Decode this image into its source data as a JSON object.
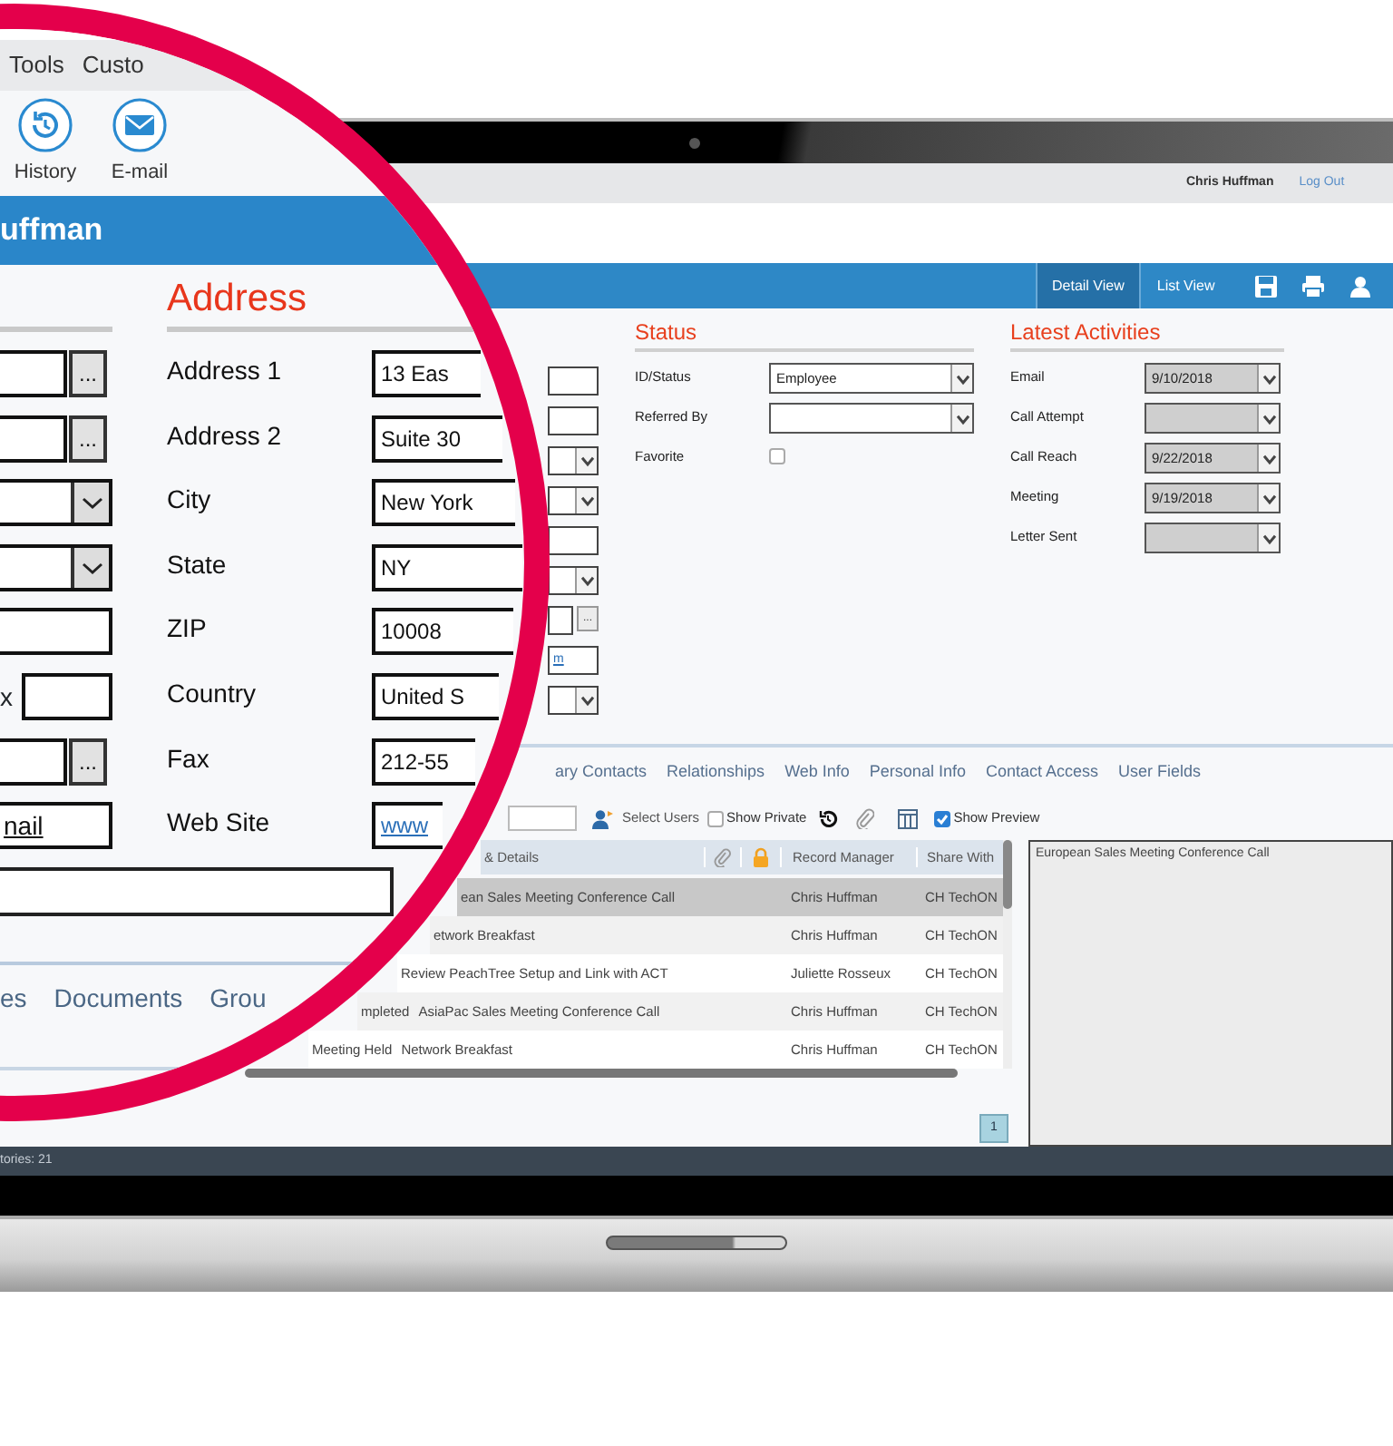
{
  "magnifier": {
    "menu": [
      {
        "label": "Tools"
      },
      {
        "label": "Custo"
      }
    ],
    "toolbar": [
      {
        "kind": "history",
        "label": "History"
      },
      {
        "kind": "email",
        "label": "E-mail"
      }
    ],
    "record_title": "uffman",
    "left_fields": [
      {
        "kind": "lookup",
        "button": "..."
      },
      {
        "kind": "lookup",
        "button": "..."
      },
      {
        "kind": "select"
      },
      {
        "kind": "select"
      },
      {
        "kind": "input"
      },
      {
        "kind": "extension",
        "label": "x"
      },
      {
        "kind": "lookup",
        "button": "..."
      },
      {
        "kind": "link",
        "value": "nail"
      }
    ],
    "address": {
      "title": "Address",
      "fields": [
        {
          "label": "Address 1",
          "kind": "input",
          "value": "13 Eas"
        },
        {
          "label": "Address 2",
          "kind": "input",
          "value": "Suite 30"
        },
        {
          "label": "City",
          "kind": "input",
          "value": "New York"
        },
        {
          "label": "State",
          "kind": "input",
          "value": "NY"
        },
        {
          "label": "ZIP",
          "kind": "input",
          "value": "10008"
        },
        {
          "label": "Country",
          "kind": "input",
          "value": "United S"
        },
        {
          "label": "Fax",
          "kind": "input",
          "value": "212-55"
        },
        {
          "label": "Web Site",
          "kind": "link",
          "value": "www"
        }
      ]
    },
    "tabs": [
      {
        "label": "es"
      },
      {
        "label": "Documents"
      },
      {
        "label": "Grou"
      }
    ]
  },
  "screen": {
    "user_bar": {
      "user": "Chris Huffman",
      "logout": "Log Out"
    },
    "view_tabs": [
      {
        "label": "Detail View",
        "selected": true
      },
      {
        "label": "List View",
        "selected": false
      }
    ],
    "view_actions": [
      {
        "kind": "save"
      },
      {
        "kind": "print"
      },
      {
        "kind": "contact"
      }
    ],
    "address_fields": [
      {
        "kind": "input"
      },
      {
        "kind": "input"
      },
      {
        "kind": "select"
      },
      {
        "kind": "select"
      },
      {
        "kind": "input"
      },
      {
        "kind": "select"
      },
      {
        "kind": "lookup",
        "button": "..."
      },
      {
        "kind": "link",
        "value": "m"
      },
      {
        "kind": "select"
      }
    ],
    "status": {
      "title": "Status",
      "fields": [
        {
          "label": "ID/Status",
          "kind": "select",
          "value": "Employee"
        },
        {
          "label": "Referred By",
          "kind": "select"
        },
        {
          "label": "Favorite",
          "kind": "checkbox",
          "checked": false
        }
      ]
    },
    "latest_activities": {
      "title": "Latest Activities",
      "fields": [
        {
          "label": "Email",
          "value": "9/10/2018"
        },
        {
          "label": "Call Attempt"
        },
        {
          "label": "Call Reach",
          "value": "9/22/2018"
        },
        {
          "label": "Meeting",
          "value": "9/19/2018"
        },
        {
          "label": "Letter Sent"
        }
      ]
    },
    "detail_tabs": [
      {
        "label": "ary Contacts",
        "selected": false
      },
      {
        "label": "Relationships",
        "selected": false
      },
      {
        "label": "Web Info",
        "selected": false
      },
      {
        "label": "Personal Info",
        "selected": false
      },
      {
        "label": "Contact Access",
        "selected": false
      },
      {
        "label": "User Fields",
        "selected": false
      }
    ],
    "toolbar": {
      "select_users": "Select Users",
      "show_private": {
        "label": "Show Private",
        "checked": false
      },
      "show_preview": {
        "label": "Show Preview",
        "checked": true
      }
    },
    "table": {
      "columns": [
        {
          "kind": "text",
          "label": "& Details"
        },
        {
          "kind": "attachment"
        },
        {
          "kind": "lock"
        },
        {
          "kind": "text",
          "label": "Record Manager"
        },
        {
          "kind": "text",
          "label": "Share With"
        }
      ],
      "rows": [
        {
          "selected": true,
          "details": "ean Sales Meeting Conference Call",
          "record_manager": "Chris Huffman",
          "share_with": "CH TechON"
        },
        {
          "selected": false,
          "details": "etwork Breakfast",
          "record_manager": "Chris Huffman",
          "share_with": "CH TechON"
        },
        {
          "selected": false,
          "details": "Review PeachTree Setup and Link with ACT",
          "record_manager": "Juliette Rosseux",
          "share_with": "CH TechON"
        },
        {
          "selected": false,
          "status": "mpleted",
          "details": "AsiaPac Sales Meeting Conference Call",
          "record_manager": "Chris Huffman",
          "share_with": "CH TechON"
        },
        {
          "selected": false,
          "status": "Meeting Held",
          "details": "Network Breakfast",
          "record_manager": "Chris Huffman",
          "share_with": "CH TechON"
        }
      ]
    },
    "preview": "European Sales Meeting Conference Call",
    "pages": [
      {
        "label": "1",
        "selected": true
      }
    ],
    "status_bar": "tories: 21"
  }
}
